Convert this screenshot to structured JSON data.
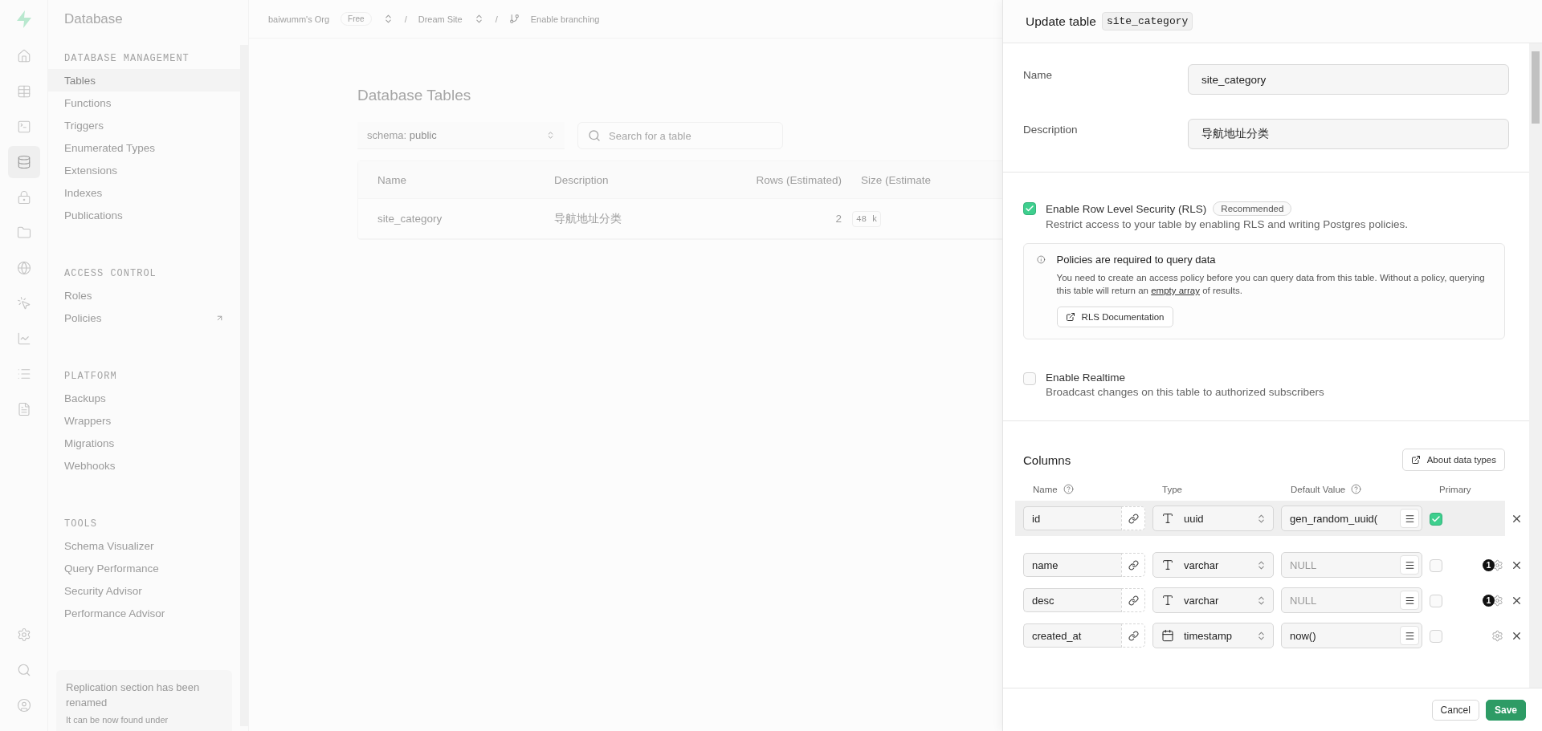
{
  "rail": {
    "top": [
      {
        "kind": "home",
        "selected": false
      },
      {
        "kind": "table",
        "selected": false
      },
      {
        "kind": "terminal",
        "selected": false
      },
      {
        "kind": "database",
        "selected": true
      },
      {
        "kind": "auth",
        "selected": false
      },
      {
        "kind": "storage",
        "selected": false
      },
      {
        "kind": "functions",
        "selected": false
      },
      {
        "kind": "realtime",
        "selected": false
      },
      {
        "kind": "reports",
        "selected": false
      },
      {
        "kind": "logs",
        "selected": false
      },
      {
        "kind": "docs",
        "selected": false
      }
    ],
    "bottom": [
      {
        "kind": "settings",
        "selected": false
      },
      {
        "kind": "search",
        "selected": false
      },
      {
        "kind": "account",
        "selected": false
      }
    ]
  },
  "sidebar": {
    "title": "Database",
    "sections": [
      {
        "heading": "DATABASE MANAGEMENT",
        "items": [
          {
            "label": "Tables",
            "selected": true,
            "external": false
          },
          {
            "label": "Functions",
            "selected": false,
            "external": false
          },
          {
            "label": "Triggers",
            "selected": false,
            "external": false
          },
          {
            "label": "Enumerated Types",
            "selected": false,
            "external": false
          },
          {
            "label": "Extensions",
            "selected": false,
            "external": false
          },
          {
            "label": "Indexes",
            "selected": false,
            "external": false
          },
          {
            "label": "Publications",
            "selected": false,
            "external": false
          }
        ]
      },
      {
        "heading": "ACCESS CONTROL",
        "items": [
          {
            "label": "Roles",
            "selected": false,
            "external": false
          },
          {
            "label": "Policies",
            "selected": false,
            "external": true
          }
        ]
      },
      {
        "heading": "PLATFORM",
        "items": [
          {
            "label": "Backups",
            "selected": false,
            "external": false
          },
          {
            "label": "Wrappers",
            "selected": false,
            "external": false
          },
          {
            "label": "Migrations",
            "selected": false,
            "external": false
          },
          {
            "label": "Webhooks",
            "selected": false,
            "external": false
          }
        ]
      },
      {
        "heading": "TOOLS",
        "items": [
          {
            "label": "Schema Visualizer",
            "selected": false,
            "external": false
          },
          {
            "label": "Query Performance",
            "selected": false,
            "external": false
          },
          {
            "label": "Security Advisor",
            "selected": false,
            "external": false
          },
          {
            "label": "Performance Advisor",
            "selected": false,
            "external": false
          }
        ]
      }
    ],
    "notice": {
      "title": "Replication section has been renamed",
      "text": "It can be now found under"
    }
  },
  "topbar": {
    "org": "baiwumm's Org",
    "plan": "Free",
    "separator_1": "/",
    "project": "Dream Site",
    "separator_2": "/",
    "branching": "Enable branching"
  },
  "main": {
    "title": "Database Tables",
    "schema_label": "schema:",
    "schema_value": "public",
    "search": {
      "placeholder": "Search for a table"
    },
    "table": {
      "columns": [
        "Name",
        "Description",
        "Rows (Estimated)",
        "Size (Estimate"
      ],
      "rows": [
        {
          "name": "site_category",
          "description": "导航地址分类",
          "rows": "2",
          "size": "48 k"
        }
      ]
    }
  },
  "panel": {
    "title": "Update table",
    "table_name": "site_category",
    "fields": [
      {
        "label": "Name",
        "value": "site_category"
      },
      {
        "label": "Description",
        "value": "导航地址分类"
      }
    ],
    "rls": {
      "checked": true,
      "label": "Enable Row Level Security (RLS)",
      "badge": "Recommended",
      "description": "Restrict access to your table by enabling RLS and writing Postgres policies."
    },
    "info": {
      "title": "Policies are required to query data",
      "text_before": "You need to create an access policy before you can query data from this table. Without a policy, querying this table will return an",
      "link": "empty array",
      "text_after": "of results.",
      "button": "RLS Documentation"
    },
    "realtime": {
      "checked": false,
      "label": "Enable Realtime",
      "description": "Broadcast changes on this table to authorized subscribers"
    },
    "columns": {
      "title": "Columns",
      "button": "About data types",
      "headers": [
        {
          "label": "Name",
          "help": true
        },
        {
          "label": "Type",
          "help": false
        },
        {
          "label": "Default Value",
          "help": true
        },
        {
          "label": "Primary",
          "help": false
        }
      ],
      "rows": [
        {
          "kind": "text",
          "name": "id",
          "type": "uuid",
          "default": "gen_random_uuid(",
          "default_placeholder": "",
          "primary": true,
          "highlighted": true,
          "badge": "",
          "settings": false
        },
        {
          "kind": "text",
          "name": "name",
          "type": "varchar",
          "default": "",
          "default_placeholder": "NULL",
          "primary": false,
          "highlighted": false,
          "badge": "1",
          "settings": true
        },
        {
          "kind": "text",
          "name": "desc",
          "type": "varchar",
          "default": "",
          "default_placeholder": "NULL",
          "primary": false,
          "highlighted": false,
          "badge": "1",
          "settings": true
        },
        {
          "kind": "date",
          "name": "created_at",
          "type": "timestamp",
          "default": "now()",
          "default_placeholder": "",
          "primary": false,
          "highlighted": false,
          "badge": "",
          "settings": true
        }
      ]
    },
    "footer": {
      "cancel": "Cancel",
      "save": "Save"
    }
  }
}
